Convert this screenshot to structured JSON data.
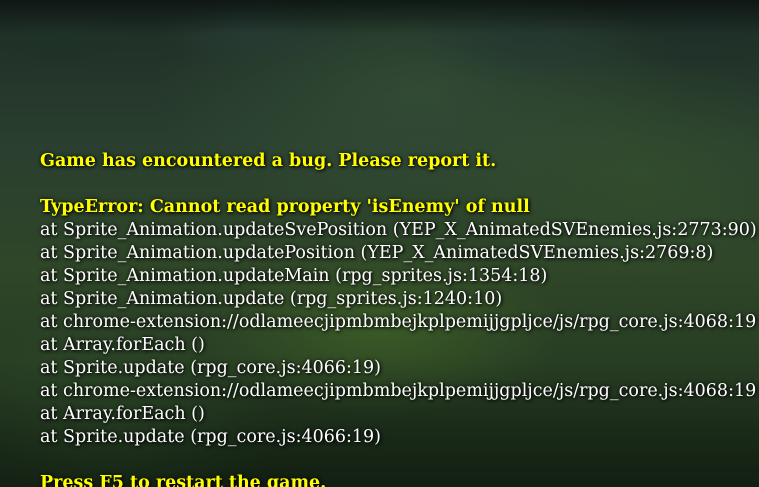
{
  "error": {
    "title": "Game has encountered a bug. Please report it.",
    "type": "TypeError: Cannot read property 'isEnemy' of null",
    "stack": [
      "at Sprite_Animation.updateSvePosition (YEP_X_AnimatedSVEnemies.js:2773:90)",
      "at Sprite_Animation.updatePosition (YEP_X_AnimatedSVEnemies.js:2769:8)",
      "at Sprite_Animation.updateMain (rpg_sprites.js:1354:18)",
      "at Sprite_Animation.update (rpg_sprites.js:1240:10)",
      "at chrome-extension://odlameecjipmbmbejkplpemijjgpljce/js/rpg_core.js:4068:19",
      "at Array.forEach ()",
      "at Sprite.update (rpg_core.js:4066:19)",
      "at chrome-extension://odlameecjipmbmbejkplpemijjgpljce/js/rpg_core.js:4068:19",
      "at Array.forEach ()",
      "at Sprite.update (rpg_core.js:4066:19)"
    ],
    "footer": "Press F5 to restart the game."
  },
  "colors": {
    "highlight": "#ffff00",
    "text": "#ffffff"
  }
}
